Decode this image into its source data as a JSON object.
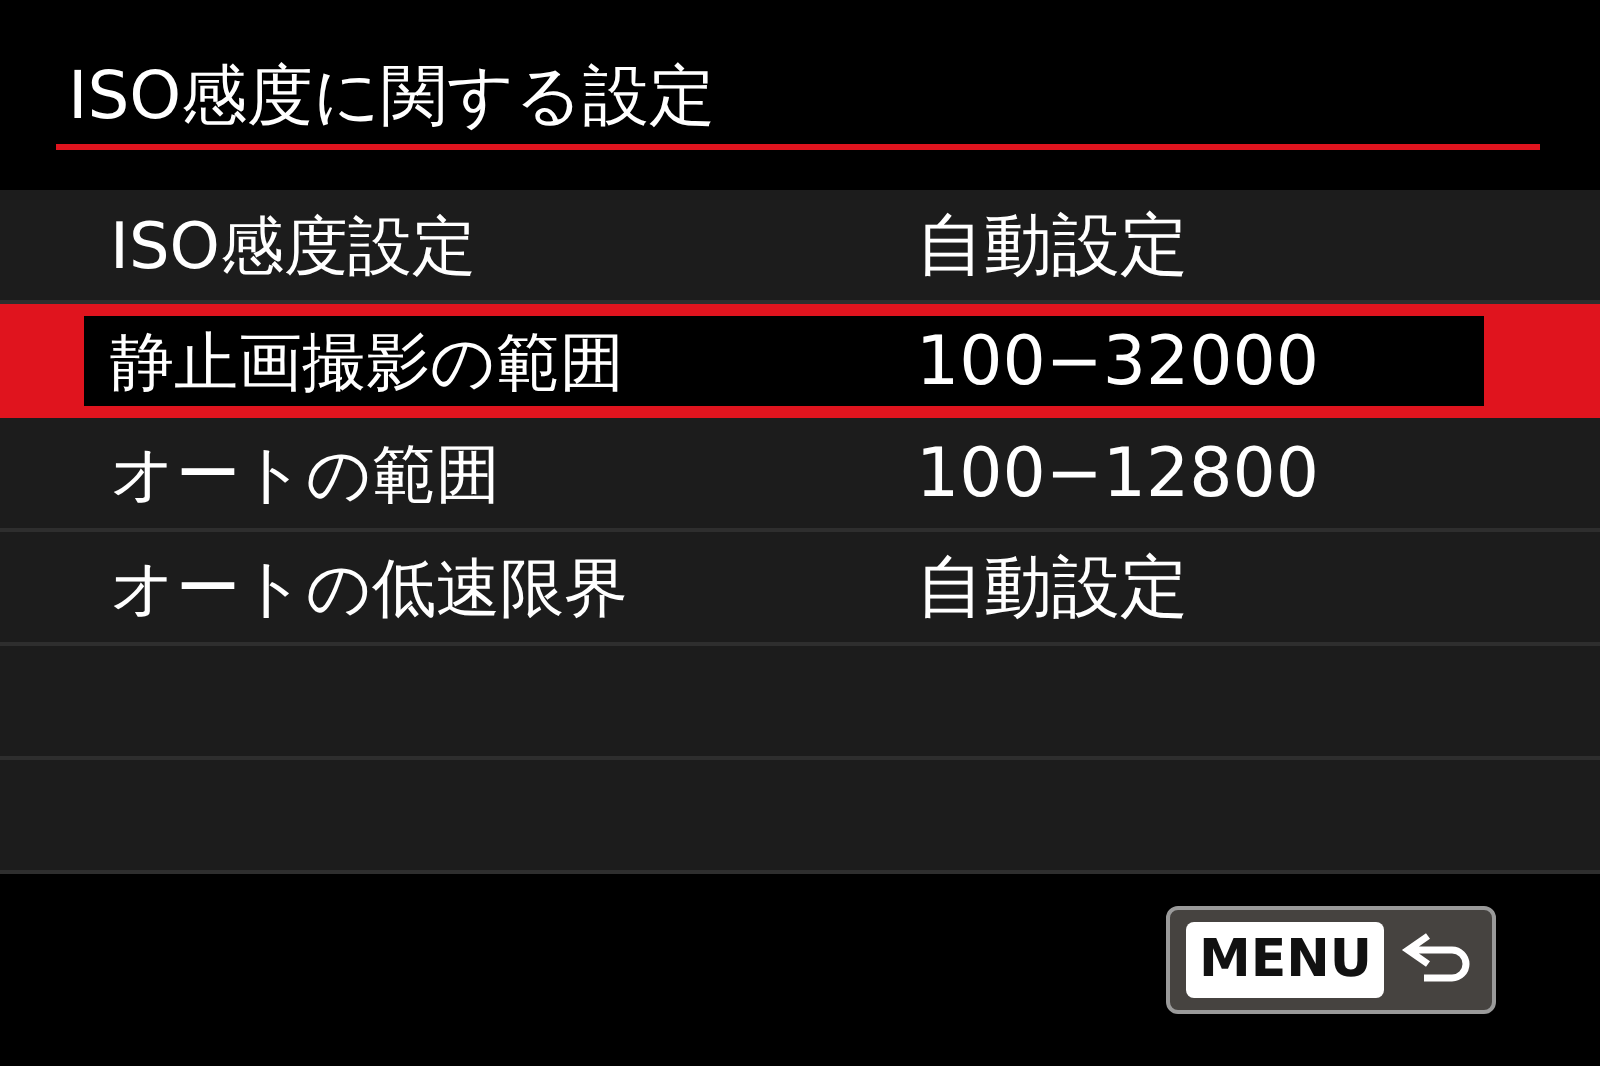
{
  "title": "ISO感度に関する設定",
  "rows": [
    {
      "label": "ISO感度設定",
      "value": "自動設定",
      "selected": false
    },
    {
      "label": "静止画撮影の範囲",
      "value": "100−32000",
      "selected": true
    },
    {
      "label": "オートの範囲",
      "value": "100−12800",
      "selected": false
    },
    {
      "label": "オートの低速限界",
      "value": "自動設定",
      "selected": false
    }
  ],
  "menu_button": {
    "label": "MENU"
  }
}
